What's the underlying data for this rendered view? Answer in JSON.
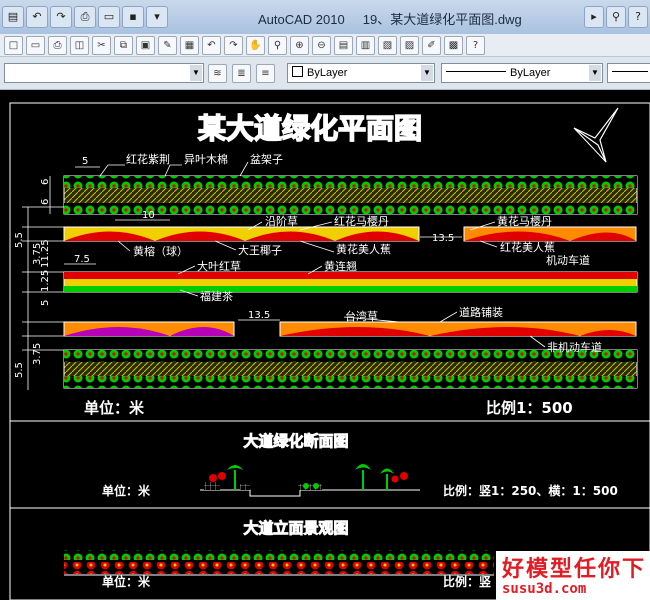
{
  "window": {
    "app_name": "AutoCAD 2010",
    "document": "19、某大道绿化平面图.dwg"
  },
  "toolbar": {
    "linetype": "ByLayer",
    "lineweight": "ByLayer"
  },
  "colors": {
    "canvas": "#000000",
    "green": "#00cc00",
    "red": "#e00000",
    "yellow": "#f0d000",
    "orange": "#ff8c00",
    "white": "#ffffff"
  },
  "plan": {
    "title": "某大道绿化平面图",
    "dims": [
      "5",
      "10",
      "6",
      "6",
      "5.5",
      "3.75",
      "11.25",
      "7.5",
      "1.25",
      "5",
      "3.75",
      "5.5",
      "13.5",
      "13.5"
    ],
    "labels": [
      "红花紫荆",
      "异叶木棉",
      "盆架子",
      "沿阶草",
      "红花马樱丹",
      "黄花马樱丹",
      "黄榕（球）",
      "大王椰子",
      "黄花美人蕉",
      "红花美人蕉",
      "机动车道",
      "大叶红草",
      "黄连翘",
      "福建茶",
      "台湾草",
      "道路铺装",
      "非机动车道"
    ],
    "unit": "单位：米",
    "scale": "比例1：500"
  },
  "section": {
    "title": "大道绿化断面图",
    "unit": "单位：米",
    "scale": "比例：竖1：250、横：1：500"
  },
  "elevation": {
    "title": "大道立面景观图",
    "unit": "单位：米",
    "scale": "比例：竖"
  },
  "watermark": {
    "text": "好模型任你下",
    "url": "susu3d.com"
  }
}
